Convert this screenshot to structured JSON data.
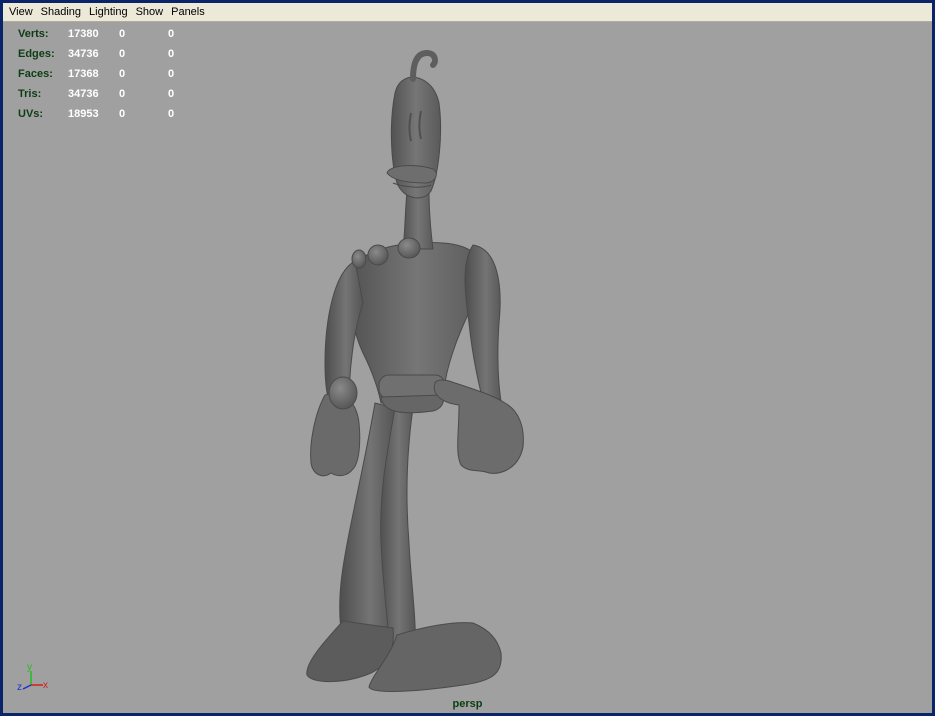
{
  "menu": {
    "items": [
      "View",
      "Shading",
      "Lighting",
      "Show",
      "Panels"
    ]
  },
  "hud": {
    "rows": [
      {
        "label": "Verts:",
        "total": "17380",
        "selected": "0",
        "component": "0"
      },
      {
        "label": "Edges:",
        "total": "34736",
        "selected": "0",
        "component": "0"
      },
      {
        "label": "Faces:",
        "total": "17368",
        "selected": "0",
        "component": "0"
      },
      {
        "label": "Tris:",
        "total": "34736",
        "selected": "0",
        "component": "0"
      },
      {
        "label": "UVs:",
        "total": "18953",
        "selected": "0",
        "component": "0"
      }
    ]
  },
  "camera": {
    "name": "persp"
  },
  "axis": {
    "x_label": "x",
    "y_label": "y",
    "z_label": "z",
    "x_color": "#d02020",
    "y_color": "#20c020",
    "z_color": "#2030d0"
  },
  "colors": {
    "viewport_bg": "#a0a0a0",
    "hud_label": "#0d3d14",
    "hud_value": "#ffffff",
    "frame_border": "#0a246a",
    "model_base": "#6a6a6a"
  }
}
